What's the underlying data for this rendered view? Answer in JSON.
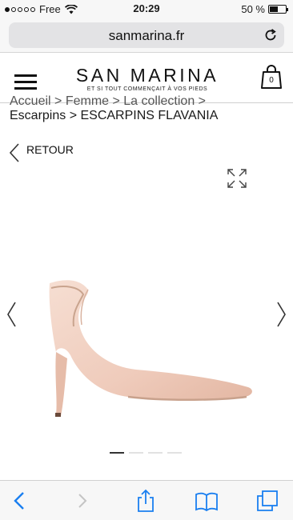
{
  "status_bar": {
    "carrier": "Free",
    "time": "20:29",
    "battery_percent": "50 %",
    "battery_level": 0.5,
    "signal_bars_filled": 1
  },
  "browser": {
    "url": "sanmarina.fr"
  },
  "site_header": {
    "logo_text": "SAN MARINA",
    "logo_tagline": "ET SI TOUT COMMENÇAIT À VOS PIEDS",
    "cart_count": "0"
  },
  "breadcrumb": {
    "line1": "Accueil > Femme > La collection >",
    "line2": "Escarpins > ESCARPINS FLAVANIA"
  },
  "back_link": {
    "label": "RETOUR"
  },
  "carousel": {
    "total_slides": 4,
    "active_slide": 1
  },
  "icons": {
    "menu": "hamburger-icon",
    "cart": "shopping-bag-icon",
    "back": "chevron-left-icon",
    "expand": "expand-icon",
    "reload": "reload-icon",
    "share": "share-icon",
    "bookmarks": "book-icon",
    "tabs": "tabs-icon"
  },
  "colors": {
    "safari_blue": "#1a7ff0",
    "shoe_pink": "#f0cfc0"
  }
}
